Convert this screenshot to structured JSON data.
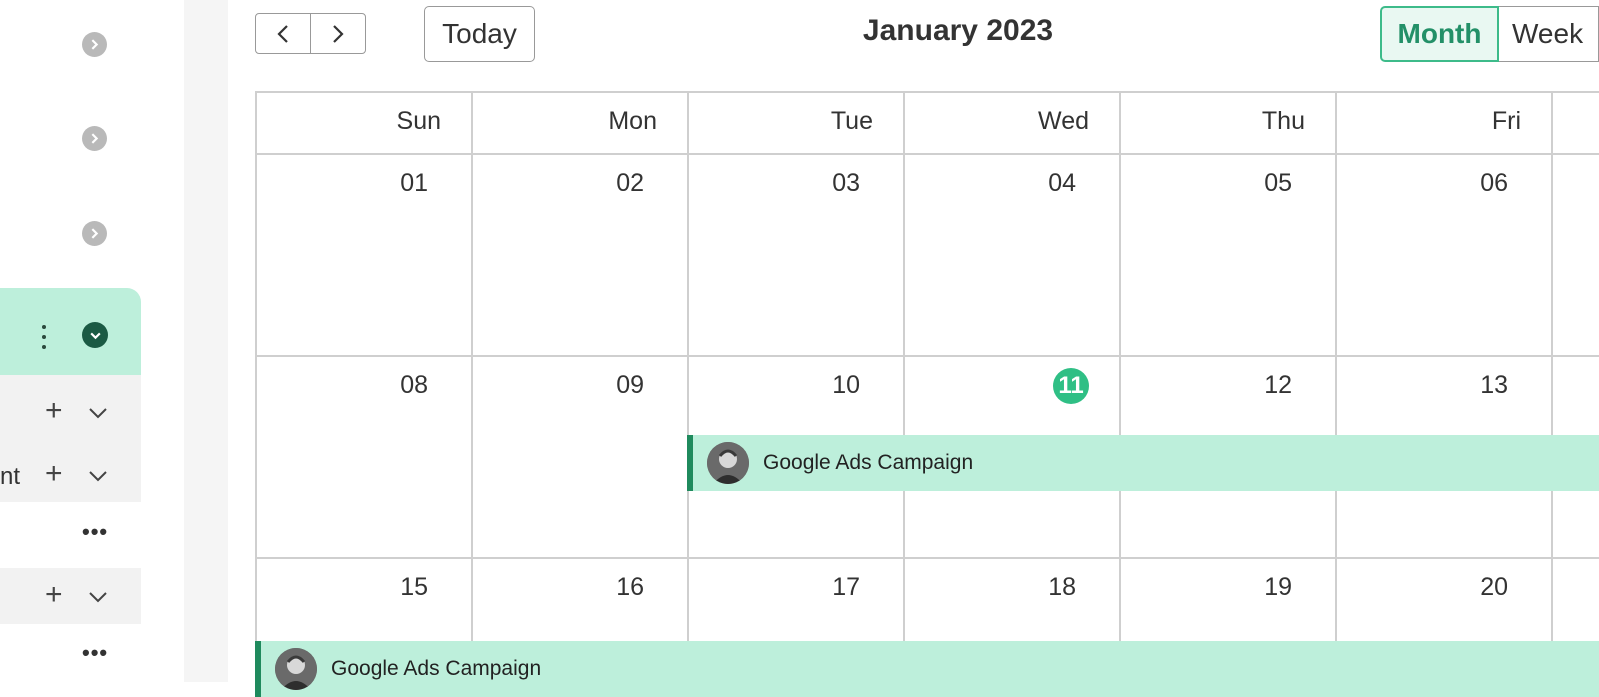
{
  "sidebar": {
    "partial_label": "nt",
    "items": [
      {
        "icon": "chevron-right-icon"
      },
      {
        "icon": "chevron-right-icon"
      },
      {
        "icon": "chevron-right-icon"
      }
    ],
    "active_item": {
      "icons": [
        "kebab-menu-icon",
        "chevron-down-icon"
      ]
    }
  },
  "toolbar": {
    "prev_icon": "chevron-left-icon",
    "next_icon": "chevron-right-icon",
    "today_label": "Today",
    "title": "January 2023",
    "views": [
      "Month",
      "Week"
    ],
    "active_view": "Month"
  },
  "calendar": {
    "weekdays": [
      "Sun",
      "Mon",
      "Tue",
      "Wed",
      "Thu",
      "Fri"
    ],
    "weeks": [
      [
        "01",
        "02",
        "03",
        "04",
        "05",
        "06"
      ],
      [
        "08",
        "09",
        "10",
        "11",
        "12",
        "13"
      ],
      [
        "15",
        "16",
        "17",
        "18",
        "19",
        "20"
      ]
    ],
    "today": "11",
    "events": [
      {
        "title": "Google Ads Campaign",
        "week": 1,
        "start_day_index": 2
      },
      {
        "title": "Google Ads Campaign",
        "week": 2,
        "start_day_index": 0
      }
    ]
  },
  "colors": {
    "accent": "#2fbf85",
    "event_bg": "#bdefdb",
    "event_border": "#1f8a5d",
    "active_view_text": "#239068"
  }
}
